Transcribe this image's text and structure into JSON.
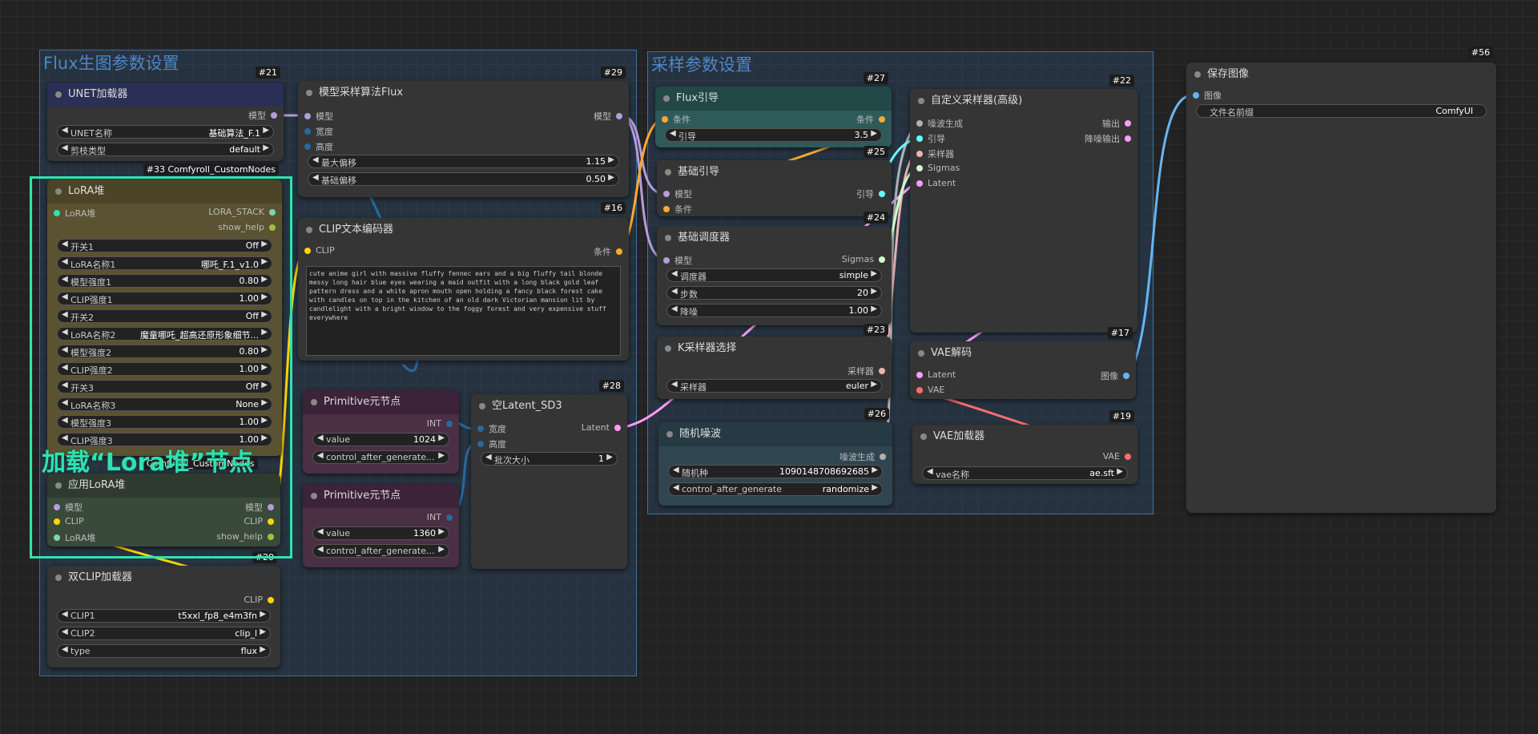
{
  "groups": {
    "flux": "Flux生图参数设置",
    "sampling": "采样参数设置"
  },
  "nodes": {
    "unet": {
      "id": "#21",
      "title": "UNET加载器",
      "out_model": "模型",
      "w1_label": "UNET名称",
      "w1_value": "基础算法_F.1",
      "w2_label": "剪枝类型",
      "w2_value": "default"
    },
    "modelsampling": {
      "id": "#29",
      "title": "模型采样算法Flux",
      "in_model": "模型",
      "in_width": "宽度",
      "in_height": "高度",
      "out_model": "模型",
      "w1_label": "最大偏移",
      "w1_value": "1.15",
      "w2_label": "基础偏移",
      "w2_value": "0.50"
    },
    "lorastack": {
      "badge": "#33 Comfyroll_CustomNodes",
      "title": "LoRA堆",
      "in_stack": "LoRA堆",
      "out_stack": "LORA_STACK",
      "out_help": "show_help",
      "widgets": [
        {
          "label": "开关1",
          "value": "Off"
        },
        {
          "label": "LoRA名称1",
          "value": "哪吒_F.1_v1.0"
        },
        {
          "label": "模型强度1",
          "value": "0.80"
        },
        {
          "label": "CLIP强度1",
          "value": "1.00"
        },
        {
          "label": "开关2",
          "value": "Off"
        },
        {
          "label": "LoRA名称2",
          "value": "魔童哪吒_超高还原形象细节..."
        },
        {
          "label": "模型强度2",
          "value": "0.80"
        },
        {
          "label": "CLIP强度2",
          "value": "1.00"
        },
        {
          "label": "开关3",
          "value": "Off"
        },
        {
          "label": "LoRA名称3",
          "value": "None"
        },
        {
          "label": "模型强度3",
          "value": "1.00"
        },
        {
          "label": "CLIP强度3",
          "value": "1.00"
        }
      ],
      "badge2": "Comfyroll_CustomNodes"
    },
    "applylora": {
      "title": "应用LoRA堆",
      "in_model": "模型",
      "in_clip": "CLIP",
      "in_stack": "LoRA堆",
      "out_model": "模型",
      "out_clip": "CLIP",
      "out_help": "show_help"
    },
    "clipencode": {
      "id": "#16",
      "title": "CLIP文本编码器",
      "in_clip": "CLIP",
      "out_cond": "条件",
      "text": "cute anime girl with massive fluffy fennec ears and a big fluffy tail blonde messy long hair blue eyes wearing a maid outfit with a long black gold leaf pattern dress and a white apron mouth open holding a fancy black forest cake with candles on top in the kitchen of an old dark Victorian mansion lit by candlelight with a bright window to the foggy forest and very expensive stuff everywhere"
    },
    "prim1": {
      "title": "Primitive元节点",
      "out": "INT",
      "w1_label": "value",
      "w1_value": "1024",
      "w2_label": "control_after_generate..."
    },
    "prim2": {
      "title": "Primitive元节点",
      "out": "INT",
      "w1_label": "value",
      "w1_value": "1360",
      "w2_label": "control_after_generate..."
    },
    "emptylatent": {
      "id": "#28",
      "title": "空Latent_SD3",
      "in_width": "宽度",
      "in_height": "高度",
      "out": "Latent",
      "w1_label": "批次大小",
      "w1_value": "1"
    },
    "dualclip": {
      "id": "#20",
      "title": "双CLIP加载器",
      "out": "CLIP",
      "w1_label": "CLIP1",
      "w1_value": "t5xxl_fp8_e4m3fn",
      "w2_label": "CLIP2",
      "w2_value": "clip_l",
      "w3_label": "type",
      "w3_value": "flux"
    },
    "fluxguide": {
      "id": "#27",
      "title": "Flux引导",
      "in_cond": "条件",
      "out_cond": "条件",
      "w1_label": "引导",
      "w1_value": "3.5"
    },
    "basicguider": {
      "id": "#25",
      "title": "基础引导",
      "in_model": "模型",
      "in_cond": "条件",
      "out": "引导"
    },
    "basicsched": {
      "id": "#24",
      "title": "基础调度器",
      "in_model": "模型",
      "out": "Sigmas",
      "w1_label": "调度器",
      "w1_value": "simple",
      "w2_label": "步数",
      "w2_value": "20",
      "w3_label": "降噪",
      "w3_value": "1.00"
    },
    "ksamplersel": {
      "id": "#23",
      "title": "K采样器选择",
      "out": "采样器",
      "w1_label": "采样器",
      "w1_value": "euler"
    },
    "randomnoise": {
      "id": "#26",
      "title": "随机噪波",
      "out": "噪波生成",
      "w1_label": "随机种",
      "w1_value": "1090148708692685",
      "w2_label": "control_after_generate",
      "w2_value": "randomize"
    },
    "customsampler": {
      "id": "#22",
      "title": "自定义采样器(高级)",
      "in_noise": "噪波生成",
      "in_guider": "引导",
      "in_sampler": "采样器",
      "in_sigmas": "Sigmas",
      "in_latent": "Latent",
      "out1": "输出",
      "out2": "降噪输出"
    },
    "vaedecode": {
      "id": "#17",
      "title": "VAE解码",
      "in_latent": "Latent",
      "in_vae": "VAE",
      "out": "图像"
    },
    "vaeloader": {
      "id": "#19",
      "title": "VAE加载器",
      "out": "VAE",
      "w1_label": "vae名称",
      "w1_value": "ae.sft"
    },
    "saveimage": {
      "id": "#56",
      "title": "保存图像",
      "in": "图像",
      "w1_label": "文件名前缀",
      "w1_value": "ComfyUI"
    }
  },
  "annotation": "加载“Lora堆”节点",
  "colors": {
    "model": "#b39ddb",
    "clip": "#ffd500",
    "cond": "#ffa931",
    "latent": "#ff9cf9",
    "vae": "#ff6e6e",
    "image": "#64b5f6",
    "int": "#29699c",
    "noise": "#b0b0b0",
    "guider": "#66ffff",
    "sampler": "#ecb4b4",
    "sigmas": "#cdffcd",
    "highlight": "#2fe2b0"
  }
}
